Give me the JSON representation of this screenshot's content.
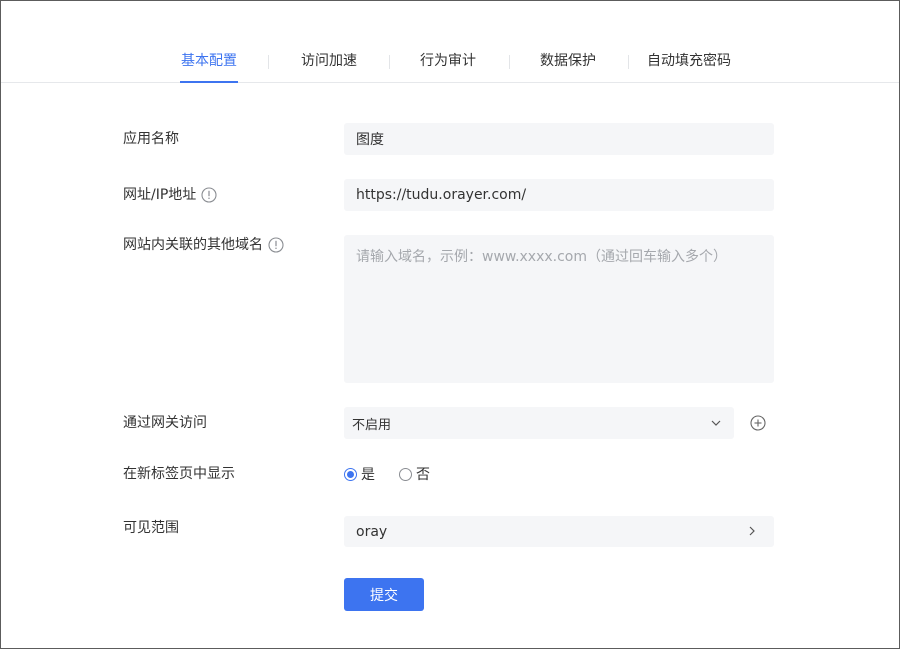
{
  "tabs": [
    {
      "label": "基本配置",
      "active": true
    },
    {
      "label": "访问加速",
      "active": false
    },
    {
      "label": "行为审计",
      "active": false
    },
    {
      "label": "数据保护",
      "active": false
    },
    {
      "label": "自动填充密码",
      "active": false
    }
  ],
  "form": {
    "app_name": {
      "label": "应用名称",
      "value": "图度"
    },
    "url": {
      "label": "网址/IP地址",
      "value": "https://tudu.orayer.com/"
    },
    "related_domains": {
      "label": "网站内关联的其他域名",
      "value": "",
      "placeholder": "请输入域名，示例：www.xxxx.com（通过回车输入多个）"
    },
    "gateway": {
      "label": "通过网关访问",
      "selected": "不启用"
    },
    "new_tab": {
      "label": "在新标签页中显示",
      "options": [
        {
          "label": "是",
          "checked": true
        },
        {
          "label": "否",
          "checked": false
        }
      ]
    },
    "scope": {
      "label": "可见范围",
      "value": "oray"
    },
    "submit_label": "提交"
  },
  "colors": {
    "accent": "#3d74f0",
    "field_bg": "#f5f6f8",
    "text": "#333333",
    "placeholder": "#a5a8ad"
  },
  "icons": {
    "info": "info-circle-icon",
    "chevron_down": "chevron-down-icon",
    "plus": "plus-circle-icon",
    "chevron_right": "chevron-right-icon"
  }
}
